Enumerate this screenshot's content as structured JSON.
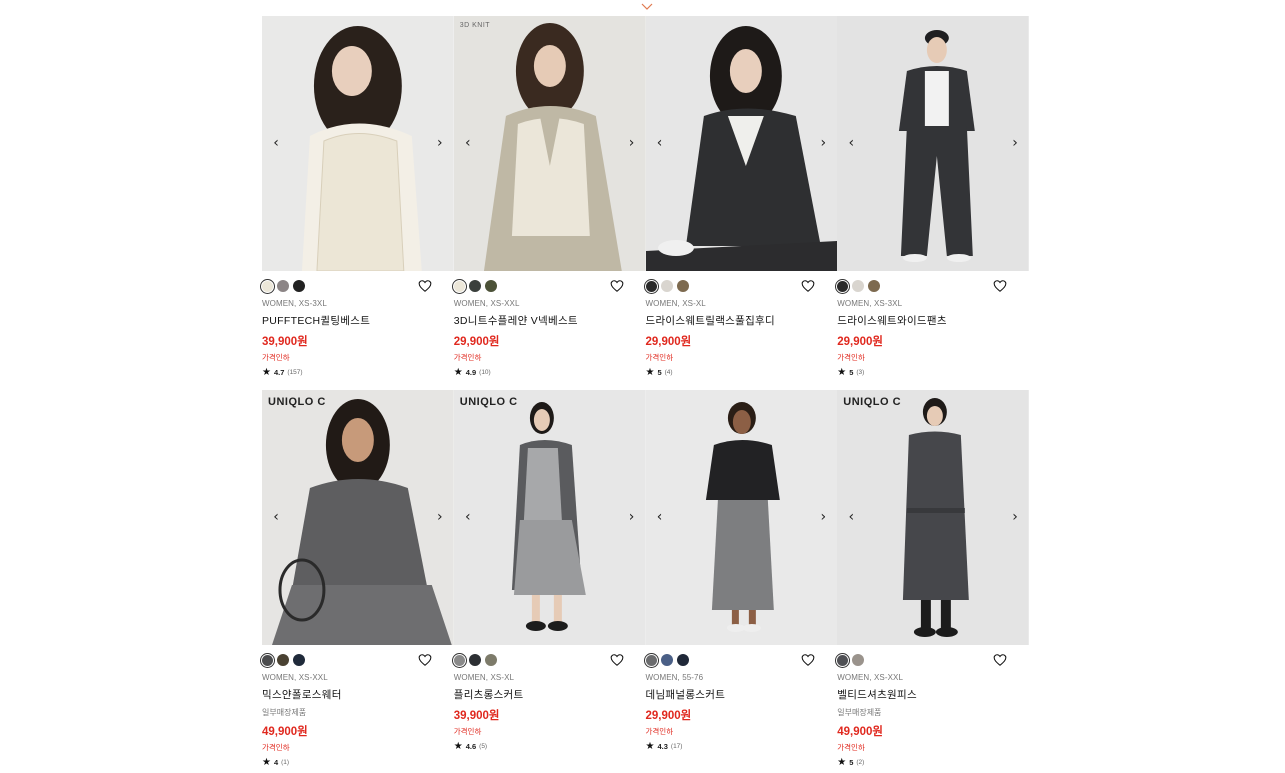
{
  "colors": {
    "price": "#e0281e",
    "text": "#1b1b1b",
    "muted": "#777777",
    "bg_image": "#e7e7e5"
  },
  "icons": {
    "top": "chevron-down-icon",
    "favorite": "heart-outline-icon",
    "rating": "star-icon",
    "prev": "chevron-left-icon",
    "next": "chevron-right-icon"
  },
  "products": [
    {
      "badge": "",
      "swatches": [
        "#ece7d9",
        "#8c8586",
        "#222222"
      ],
      "meta": "WOMEN, XS-3XL",
      "name": "PUFFTECH퀼팅베스트",
      "note": "",
      "price": "39,900원",
      "discount": "가격인하",
      "rating": "4.7",
      "review_count": "(157)",
      "palette": {
        "bg": "#e9e9e8",
        "garment": "#ece6d6",
        "hair": "#2a211b",
        "under": "#f3efe6"
      }
    },
    {
      "badge": "3D KNIT",
      "swatches": [
        "#ece7d9",
        "#3a3f3c",
        "#4c5238"
      ],
      "meta": "WOMEN, XS-XXL",
      "name": "3D니트수플레얀 V넥베스트",
      "note": "",
      "price": "29,900원",
      "discount": "가격인하",
      "rating": "4.9",
      "review_count": "(10)",
      "palette": {
        "bg": "#e4e3df",
        "garment": "#ebe6d9",
        "hair": "#3a2a20",
        "under": "#bfb8a5"
      }
    },
    {
      "badge": "",
      "swatches": [
        "#2a2a2a",
        "#d9d5cf",
        "#7d6a4f"
      ],
      "meta": "WOMEN, XS-XL",
      "name": "드라이스웨트릴랙스풀집후디",
      "note": "",
      "price": "29,900원",
      "discount": "가격인하",
      "rating": "5",
      "review_count": "(4)",
      "palette": {
        "bg": "#e6e6e6",
        "garment": "#2e2f31",
        "hair": "#1e1a18",
        "under": "#efefec"
      }
    },
    {
      "badge": "",
      "swatches": [
        "#2a2a2a",
        "#d9d5cf",
        "#7d6a4f"
      ],
      "meta": "WOMEN, XS-3XL",
      "name": "드라이스웨트와이드팬츠",
      "note": "",
      "price": "29,900원",
      "discount": "가격인하",
      "rating": "5",
      "review_count": "(3)",
      "palette": {
        "bg": "#e3e3e3",
        "garment": "#333437",
        "hair": "#1e1a18",
        "under": "#f2f2f2"
      }
    },
    {
      "badge": "UNIQLO C",
      "swatches": [
        "#4b4c4e",
        "#4a4232",
        "#1f2a3a"
      ],
      "meta": "WOMEN, XS-XXL",
      "name": "믹스얀폴로스웨터",
      "note": "일부매장제품",
      "price": "49,900원",
      "discount": "가격인하",
      "rating": "4",
      "review_count": "(1)",
      "palette": {
        "bg": "#e6e5e3",
        "garment": "#5e5e60",
        "hair": "#211a16",
        "under": "#6e6e70"
      }
    },
    {
      "badge": "UNIQLO C",
      "swatches": [
        "#8a8a8a",
        "#2c2f33",
        "#7d7b6a"
      ],
      "meta": "WOMEN, XS-XL",
      "name": "플리츠롱스커트",
      "note": "",
      "price": "39,900원",
      "discount": "가격인하",
      "rating": "4.6",
      "review_count": "(5)",
      "palette": {
        "bg": "#e7e7e7",
        "garment": "#5a5b5e",
        "hair": "#1e1a18",
        "under": "#9a9b9d"
      }
    },
    {
      "badge": "",
      "swatches": [
        "#6b6c6e",
        "#4a5f86",
        "#1f2838"
      ],
      "meta": "WOMEN, 55-76",
      "name": "데님패널롱스커트",
      "note": "",
      "price": "29,900원",
      "discount": "가격인하",
      "rating": "4.3",
      "review_count": "(17)",
      "palette": {
        "bg": "#e9e9e9",
        "garment": "#222224",
        "hair": "#2a1e16",
        "under": "#7d7e80"
      }
    },
    {
      "badge": "UNIQLO C",
      "swatches": [
        "#4f5054",
        "#9a938c"
      ],
      "meta": "WOMEN, XS-XXL",
      "name": "벨티드셔츠원피스",
      "note": "일부매장제품",
      "price": "49,900원",
      "discount": "가격인하",
      "rating": "5",
      "review_count": "(2)",
      "palette": {
        "bg": "#e4e4e4",
        "garment": "#46474b",
        "hair": "#1e1a18",
        "under": "#46474b"
      }
    }
  ]
}
